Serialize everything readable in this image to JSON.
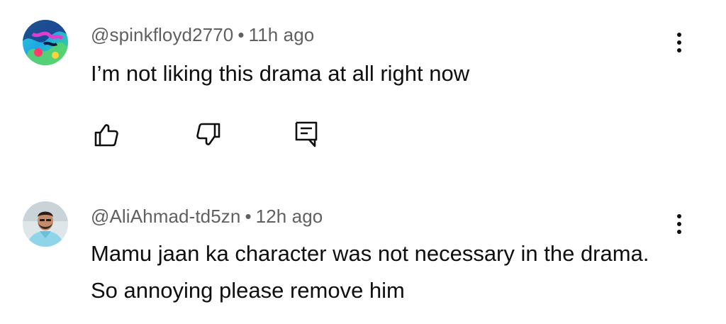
{
  "comments": [
    {
      "handle": "@spinkfloyd2770",
      "separator": "•",
      "time": "11h ago",
      "text": "I’m not liking this drama at all right now",
      "avatar_icon": "colorful-abstract-avatar",
      "actions": [
        "like-icon",
        "dislike-icon",
        "reply-icon"
      ]
    },
    {
      "handle": "@AliAhmad-td5zn",
      "separator": "•",
      "time": "12h ago",
      "text": "Mamu jaan ka character was not necessary in the drama. So annoying please remove him",
      "avatar_icon": "person-photo-avatar"
    }
  ],
  "colors": {
    "meta_text": "#606060",
    "body_text": "#0f0f0f",
    "background": "#ffffff"
  }
}
